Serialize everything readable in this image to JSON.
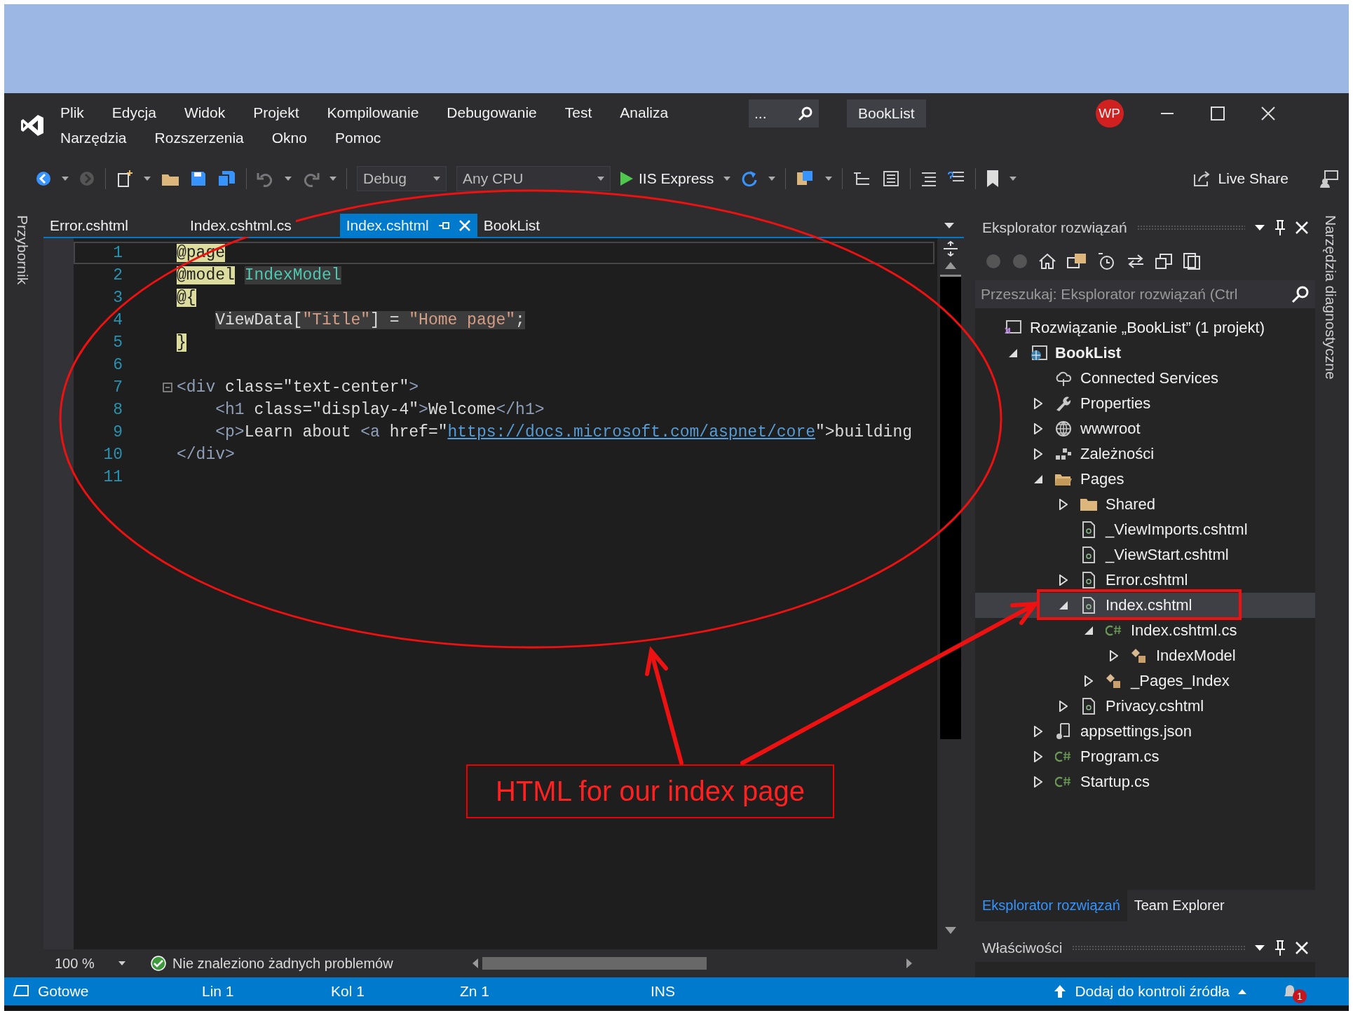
{
  "menu": {
    "items": [
      "Plik",
      "Edycja",
      "Widok",
      "Projekt",
      "Kompilowanie",
      "Debugowanie",
      "Test",
      "Analiza",
      "Narzędzia",
      "Rozszerzenia",
      "Okno",
      "Pomoc"
    ]
  },
  "quick_launch": {
    "text": "..."
  },
  "title": "BookList",
  "account": {
    "initials": "WP"
  },
  "toolbar": {
    "configuration": "Debug",
    "platform": "Any CPU",
    "run_target": "IIS Express",
    "live_share": "Live Share"
  },
  "side_left": "Przybornik",
  "side_right": "Narzędzia diagnostyczne",
  "editor": {
    "tabs": [
      {
        "label": "Error.cshtml",
        "selected": false
      },
      {
        "label": "Index.cshtml.cs",
        "selected": false
      },
      {
        "label": "Index.cshtml",
        "selected": true
      },
      {
        "label": "BookList",
        "selected": false
      }
    ],
    "lines": [
      {
        "number": "1",
        "current": true,
        "fold": false,
        "indented": false,
        "tokens": [
          {
            "kind": "razor",
            "text": "@page"
          }
        ]
      },
      {
        "number": "2",
        "current": false,
        "fold": false,
        "indented": false,
        "tokens": [
          {
            "kind": "razor",
            "text": "@model"
          },
          {
            "kind": "type",
            "text": "IndexModel"
          }
        ]
      },
      {
        "number": "3",
        "current": false,
        "fold": false,
        "indented": false,
        "tokens": [
          {
            "kind": "razor",
            "text": "@{"
          }
        ]
      },
      {
        "number": "4",
        "current": false,
        "fold": false,
        "indented": true,
        "tokens": [
          {
            "kind": "code",
            "text": "ViewData["
          },
          {
            "kind": "codestr",
            "text": "\"Title\""
          },
          {
            "kind": "code",
            "text": "] = "
          },
          {
            "kind": "codestr",
            "text": "\"Home page\""
          },
          {
            "kind": "code",
            "text": ";"
          }
        ]
      },
      {
        "number": "5",
        "current": false,
        "fold": false,
        "indented": false,
        "tokens": [
          {
            "kind": "razor",
            "text": "}"
          }
        ]
      },
      {
        "number": "6",
        "current": false,
        "fold": false
      },
      {
        "number": "7",
        "current": false,
        "fold": true,
        "indented": false,
        "tokens": [
          {
            "kind": "tag",
            "text": "<div"
          },
          {
            "kind": "text",
            "text": " class=\"text-center\""
          },
          {
            "kind": "tag",
            "text": ">"
          }
        ]
      },
      {
        "number": "8",
        "current": false,
        "fold": false,
        "indented": true,
        "tokens": [
          {
            "kind": "tag",
            "text": "<h1"
          },
          {
            "kind": "text",
            "text": " class=\"display-4\""
          },
          {
            "kind": "tag",
            "text": ">"
          },
          {
            "kind": "text",
            "text": "Welcome"
          },
          {
            "kind": "tag",
            "text": "</h1>"
          }
        ]
      },
      {
        "number": "9",
        "current": false,
        "fold": false,
        "indented": true,
        "tokens": [
          {
            "kind": "tag",
            "text": "<p>"
          },
          {
            "kind": "text",
            "text": "Learn about "
          },
          {
            "kind": "tag",
            "text": "<a"
          },
          {
            "kind": "text",
            "text": " href=\""
          },
          {
            "kind": "link",
            "text": "https://docs.microsoft.com/aspnet/core"
          },
          {
            "kind": "text",
            "text": "\">building"
          }
        ]
      },
      {
        "number": "10",
        "current": false,
        "fold": false,
        "indented": false,
        "tokens": [
          {
            "kind": "tag",
            "text": "</div>"
          }
        ]
      },
      {
        "number": "11",
        "current": false,
        "fold": false
      }
    ],
    "zoom": "100 %",
    "problems": "Nie znaleziono żadnych problemów"
  },
  "solution_explorer": {
    "title": "Eksplorator rozwiązań",
    "search": {
      "placeholder": "Przeszukaj: Eksplorator rozwiązań (Ctrl"
    },
    "tree": [
      {
        "label": "Rozwiązanie „BookList” (1 projekt)",
        "kind": "solution",
        "selected": false,
        "children": [
          {
            "label": "BookList",
            "kind": "project",
            "expanded": true,
            "selected": false,
            "children": [
              {
                "label": "Connected Services",
                "kind": "service",
                "selected": false
              },
              {
                "label": "Properties",
                "kind": "properties",
                "expanded": false,
                "selected": false
              },
              {
                "label": "wwwroot",
                "kind": "webroot",
                "expanded": false,
                "selected": false
              },
              {
                "label": "Zależności",
                "kind": "dependencies",
                "expanded": false,
                "selected": false
              },
              {
                "label": "Pages",
                "kind": "open-folder",
                "expanded": true,
                "selected": false,
                "children": [
                  {
                    "label": "Shared",
                    "kind": "folder",
                    "expanded": false,
                    "selected": false
                  },
                  {
                    "label": "_ViewImports.cshtml",
                    "kind": "razor",
                    "selected": false
                  },
                  {
                    "label": "_ViewStart.cshtml",
                    "kind": "razor",
                    "selected": false
                  },
                  {
                    "label": "Error.cshtml",
                    "kind": "razor",
                    "expanded": false,
                    "selected": false
                  },
                  {
                    "label": "Index.cshtml",
                    "kind": "razor",
                    "expanded": true,
                    "selected": true,
                    "children": [
                      {
                        "label": "Index.cshtml.cs",
                        "kind": "csharp",
                        "expanded": true,
                        "selected": false,
                        "children": [
                          {
                            "label": "IndexModel",
                            "kind": "class",
                            "expanded": false,
                            "selected": false
                          }
                        ]
                      },
                      {
                        "label": "_Pages_Index",
                        "kind": "class",
                        "expanded": false,
                        "selected": false
                      }
                    ]
                  },
                  {
                    "label": "Privacy.cshtml",
                    "kind": "razor",
                    "expanded": false,
                    "selected": false
                  }
                ]
              },
              {
                "label": "appsettings.json",
                "kind": "json",
                "expanded": false,
                "selected": false
              },
              {
                "label": "Program.cs",
                "kind": "csharp",
                "expanded": false,
                "selected": false
              },
              {
                "label": "Startup.cs",
                "kind": "csharp",
                "expanded": false,
                "selected": false
              }
            ]
          }
        ]
      }
    ],
    "tabs": [
      {
        "label": "Eksplorator rozwiązań",
        "selected": true
      },
      {
        "label": "Team Explorer",
        "selected": false
      }
    ]
  },
  "properties": {
    "title": "Właściwości"
  },
  "status_bar": {
    "state": "Gotowe",
    "line": "Lin 1",
    "column": "Kol 1",
    "char": "Zn 1",
    "mode": "INS",
    "source_control": "Dodaj do kontroli źródła",
    "notifications": "1"
  },
  "annotation": {
    "label": "HTML for our index page"
  }
}
